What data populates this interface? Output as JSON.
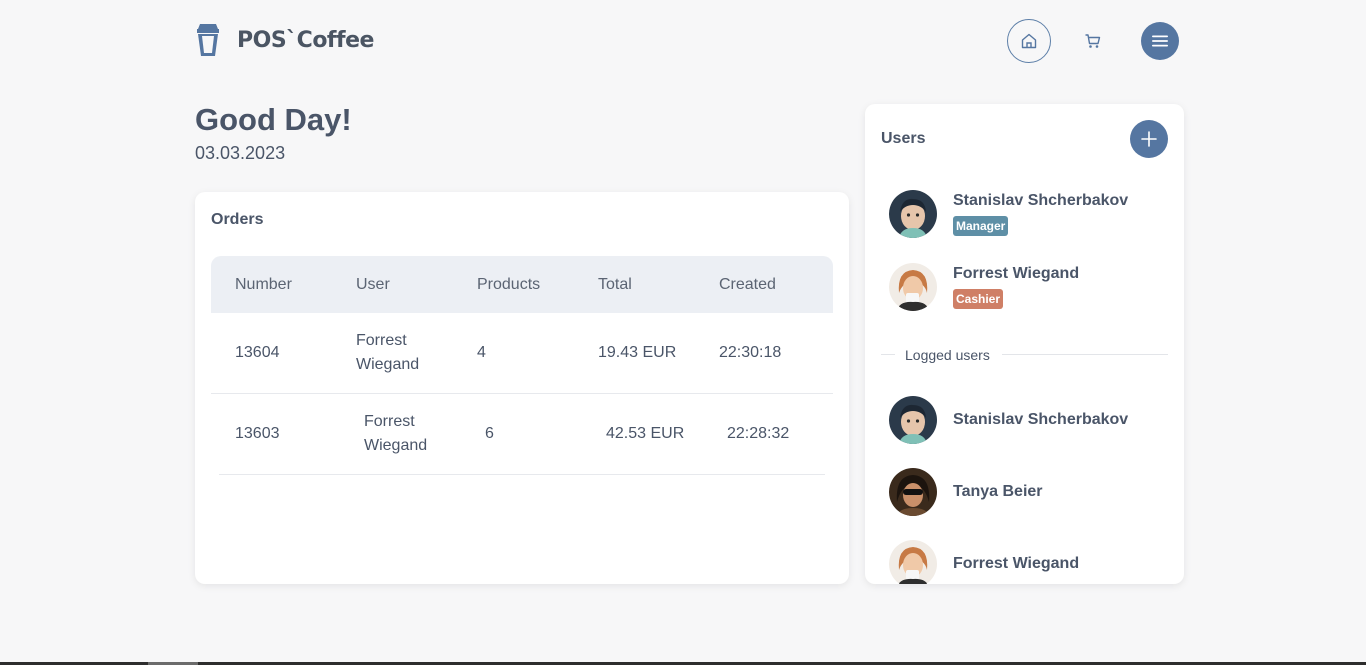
{
  "app": {
    "logo_text": "POS`Coffee"
  },
  "header": {
    "home_icon": "home-icon",
    "cart_icon": "cart-icon",
    "menu_icon": "menu-icon"
  },
  "greeting": {
    "title": "Good Day!",
    "date": "03.03.2023"
  },
  "orders": {
    "title": "Orders",
    "columns": [
      "Number",
      "User",
      "Products",
      "Total",
      "Created"
    ],
    "rows": [
      {
        "number": "13604",
        "user": "Forrest Wiegand",
        "products": "4",
        "total": "19.43 EUR",
        "created": "22:30:18"
      },
      {
        "number": "13603",
        "user": "Forrest Wiegand",
        "products": "6",
        "total": "42.53 EUR",
        "created": "22:28:32"
      }
    ]
  },
  "users": {
    "title": "Users",
    "add_icon": "plus-icon",
    "list": [
      {
        "name": "Stanislav Shcherbakov",
        "role": "Manager"
      },
      {
        "name": "Forrest Wiegand",
        "role": "Cashier"
      }
    ],
    "logged_label": "Logged users",
    "logged": [
      {
        "name": "Stanislav Shcherbakov"
      },
      {
        "name": "Tanya Beier"
      },
      {
        "name": "Forrest Wiegand"
      }
    ]
  },
  "colors": {
    "accent": "#5576a1",
    "manager": "#5e8fa6",
    "cashier": "#cf7f66",
    "background": "#f7f7f8"
  }
}
